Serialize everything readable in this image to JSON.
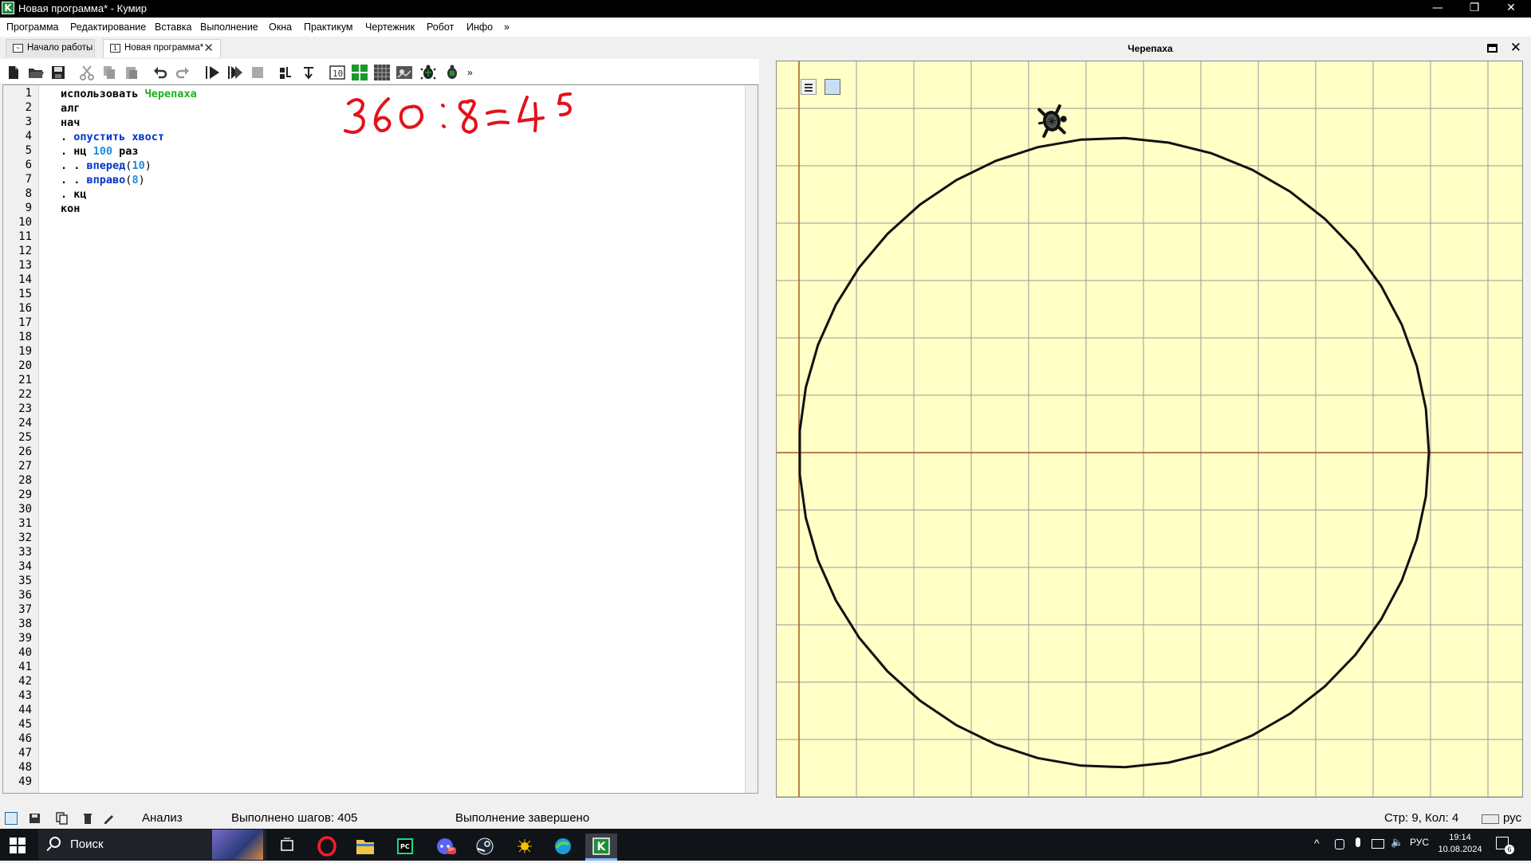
{
  "window": {
    "title": "Новая программа* - Кумир",
    "app_icon_letter": "K",
    "controls": {
      "minimize": "—",
      "restore": "❐",
      "close": "✕"
    }
  },
  "menu": [
    "Программа",
    "Редактирование",
    "Вставка",
    "Выполнение",
    "Окна",
    "Практикум",
    "Чертежник",
    "Робот",
    "Инфо",
    "»"
  ],
  "tabs": [
    {
      "label": "Начало работы",
      "active": false
    },
    {
      "label": "Новая программа*",
      "active": true,
      "close": "✕"
    }
  ],
  "toolbar": {
    "buttons": [
      "new-file",
      "open-file",
      "save-file",
      "cut",
      "copy",
      "paste",
      "undo",
      "redo",
      "run",
      "run-step",
      "stop",
      "step-into",
      "step-out",
      "io-window",
      "robot-field",
      "grid-field",
      "drawer-field",
      "turtle",
      "turtle-settings"
    ],
    "overflow": "»"
  },
  "editor": {
    "line_numbers": [
      "1",
      "2",
      "3",
      "4",
      "5",
      "6",
      "7",
      "8",
      "9",
      "10",
      "11",
      "12",
      "13",
      "14",
      "15",
      "16",
      "17",
      "18",
      "19",
      "20",
      "21",
      "22",
      "23",
      "24",
      "25",
      "26",
      "27",
      "28",
      "29",
      "30",
      "31",
      "32",
      "33",
      "34",
      "35",
      "36",
      "37",
      "38",
      "39",
      "40",
      "41",
      "42",
      "43",
      "44",
      "45",
      "46",
      "47",
      "48",
      "49"
    ],
    "code": {
      "line1_kw": "использовать ",
      "line1_name": "Черепаха",
      "line2": "алг",
      "line3": "нач",
      "line4_dot": ". ",
      "line4_cmd": "опустить хвост",
      "line5_dot": ". нц ",
      "line5_num": "100",
      "line5_end": " раз",
      "line6_dots": ". . ",
      "line6_cmd": "вперед",
      "line6_open": "(",
      "line6_num": "10",
      "line6_close": ")",
      "line7_dots": ". . ",
      "line7_cmd": "вправо",
      "line7_open": "(",
      "line7_num": "8",
      "line7_close": ")",
      "line8": ". кц",
      "line9": "кон"
    },
    "handwritten_note": "360 :8= 45",
    "handwriting_color": "#e3121b"
  },
  "turtle_panel": {
    "title": "Черепаха",
    "float_icon": "float-window-icon",
    "close": "✕",
    "canvas_bg": "#ffffc6",
    "path_color": "#111111",
    "axis_color": "#a0581c",
    "color_swatch": "#c8e0f5"
  },
  "status": {
    "analysis": "Анализ",
    "steps": "Выполнено шагов: 405",
    "state": "Выполнение завершено",
    "position": "Стр: 9, Кол: 4",
    "layout": "рус"
  },
  "taskbar": {
    "search_placeholder": "Поиск",
    "apps": [
      "task-view",
      "opera",
      "file-explorer",
      "pycharm",
      "discord",
      "steam",
      "unknown-app",
      "edge",
      "kumir"
    ],
    "discord_badge": "9+",
    "lang": "РУС",
    "time": "19:14",
    "date": "10.08.2024",
    "notif_count": "6"
  }
}
